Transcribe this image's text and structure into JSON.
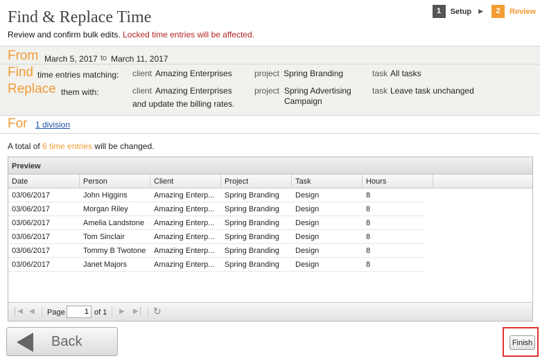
{
  "page": {
    "title": "Find & Replace Time",
    "subtitle": "Review and confirm bulk edits.",
    "warning": "Locked time entries will be affected."
  },
  "steps": [
    {
      "num": "1",
      "label": "Setup"
    },
    {
      "num": "2",
      "label": "Review"
    }
  ],
  "summary": {
    "from_label": "From",
    "from_date": "March 5, 2017",
    "to_word": "to",
    "to_date": "March 11, 2017",
    "find_label": "Find",
    "find_text": "time entries matching:",
    "find_client_key": "client",
    "find_client": "Amazing Enterprises",
    "find_project_key": "project",
    "find_project": "Spring Branding",
    "find_task_key": "task",
    "find_task": "All tasks",
    "replace_label": "Replace",
    "replace_text": "them with:",
    "replace_client_key": "client",
    "replace_client": "Amazing Enterprises",
    "replace_billing": "and update the billing rates.",
    "replace_project_key": "project",
    "replace_project_line1": "Spring Advertising",
    "replace_project_line2": "Campaign",
    "replace_task_key": "task",
    "replace_task": "Leave task unchanged",
    "for_label": "For",
    "for_link": "1 division"
  },
  "total": {
    "prefix": "A total of",
    "count": "6 time entries",
    "suffix": "will be changed."
  },
  "grid": {
    "title": "Preview",
    "columns": [
      "Date",
      "Person",
      "Client",
      "Project",
      "Task",
      "Hours"
    ],
    "rows": [
      [
        "03/06/2017",
        "John Higgins",
        "Amazing Enterp...",
        "Spring Branding",
        "Design",
        "8"
      ],
      [
        "03/06/2017",
        "Morgan Riley",
        "Amazing Enterp...",
        "Spring Branding",
        "Design",
        "8"
      ],
      [
        "03/06/2017",
        "Amelia Landstone",
        "Amazing Enterp...",
        "Spring Branding",
        "Design",
        "8"
      ],
      [
        "03/06/2017",
        "Tom Sinclair",
        "Amazing Enterp...",
        "Spring Branding",
        "Design",
        "8"
      ],
      [
        "03/06/2017",
        "Tommy B Twotone",
        "Amazing Enterp...",
        "Spring Branding",
        "Design",
        "8"
      ],
      [
        "03/06/2017",
        "Janet Majors",
        "Amazing Enterp...",
        "Spring Branding",
        "Design",
        "8"
      ]
    ]
  },
  "pager": {
    "page_label": "Page",
    "page_value": "1",
    "of_label": "of 1"
  },
  "buttons": {
    "back": "Back",
    "finish": "Finish"
  },
  "colors": {
    "accent": "#f39c34",
    "warning": "#b22222",
    "highlight_box": "#e03030"
  }
}
